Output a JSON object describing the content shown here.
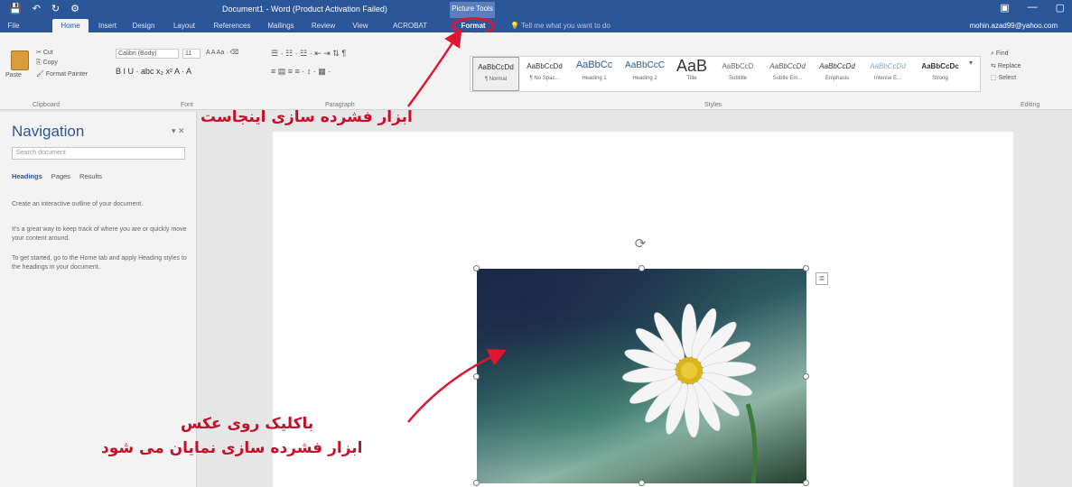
{
  "title_bar": {
    "quick_access": [
      "💾",
      "↶",
      "↻",
      "⚙"
    ],
    "doc_title": "Document1 - Word (Product Activation Failed)",
    "context_group": "Picture Tools",
    "window_controls": [
      "▣",
      "—",
      "▢"
    ]
  },
  "tabs": [
    "File",
    "Home",
    "Insert",
    "Design",
    "Layout",
    "References",
    "Mailings",
    "Review",
    "View",
    "ACROBAT",
    "Format"
  ],
  "tell_me": "Tell me what you want to do",
  "account": "mohin.azad99@yahoo.com",
  "ribbon": {
    "clipboard": {
      "cut": "Cut",
      "copy": "Copy",
      "format_painter": "Format Painter",
      "paste": "Paste",
      "group": "Clipboard"
    },
    "font": {
      "font_name": "Calibri (Body)",
      "font_size": "11",
      "group": "Font",
      "row2": "B  I  U  ·  abc  x₂  x²  A  ·  A"
    },
    "paragraph": {
      "group": "Paragraph"
    },
    "styles": {
      "group": "Styles",
      "items": [
        {
          "sample": "AaBbCcDd",
          "name": "¶ Normal"
        },
        {
          "sample": "AaBbCcDd",
          "name": "¶ No Spac..."
        },
        {
          "sample": "AaBbCc",
          "name": "Heading 1"
        },
        {
          "sample": "AaBbCcC",
          "name": "Heading 2"
        },
        {
          "sample": "AaB",
          "name": "Title"
        },
        {
          "sample": "AaBbCcD",
          "name": "Subtitle"
        },
        {
          "sample": "AaBbCcDd",
          "name": "Subtle Em..."
        },
        {
          "sample": "AaBbCcDd",
          "name": "Emphasis"
        },
        {
          "sample": "AaBbCcDd",
          "name": "Intense E..."
        },
        {
          "sample": "AaBbCcDc",
          "name": "Strong"
        }
      ]
    },
    "editing": {
      "find": "Find",
      "replace": "Replace",
      "select": "Select",
      "group": "Editing"
    }
  },
  "navigation": {
    "title": "Navigation",
    "search_placeholder": "Search document",
    "tabs": [
      "Headings",
      "Pages",
      "Results"
    ],
    "paragraphs": [
      "Create an interactive outline of your document.",
      "It's a great way to keep track of where you are or quickly move your content around.",
      "To get started, go to the Home tab and apply Heading styles to the headings in your document."
    ]
  },
  "annotations": {
    "ribbon_note": "ابزار فشرده سازی اینجاست",
    "click_note": "باکلیک روی عکس",
    "appear_note": "ابزار فشرده سازی نمایان می شود"
  },
  "colors": {
    "brand": "#2b579a",
    "annotation": "#c3102d"
  }
}
